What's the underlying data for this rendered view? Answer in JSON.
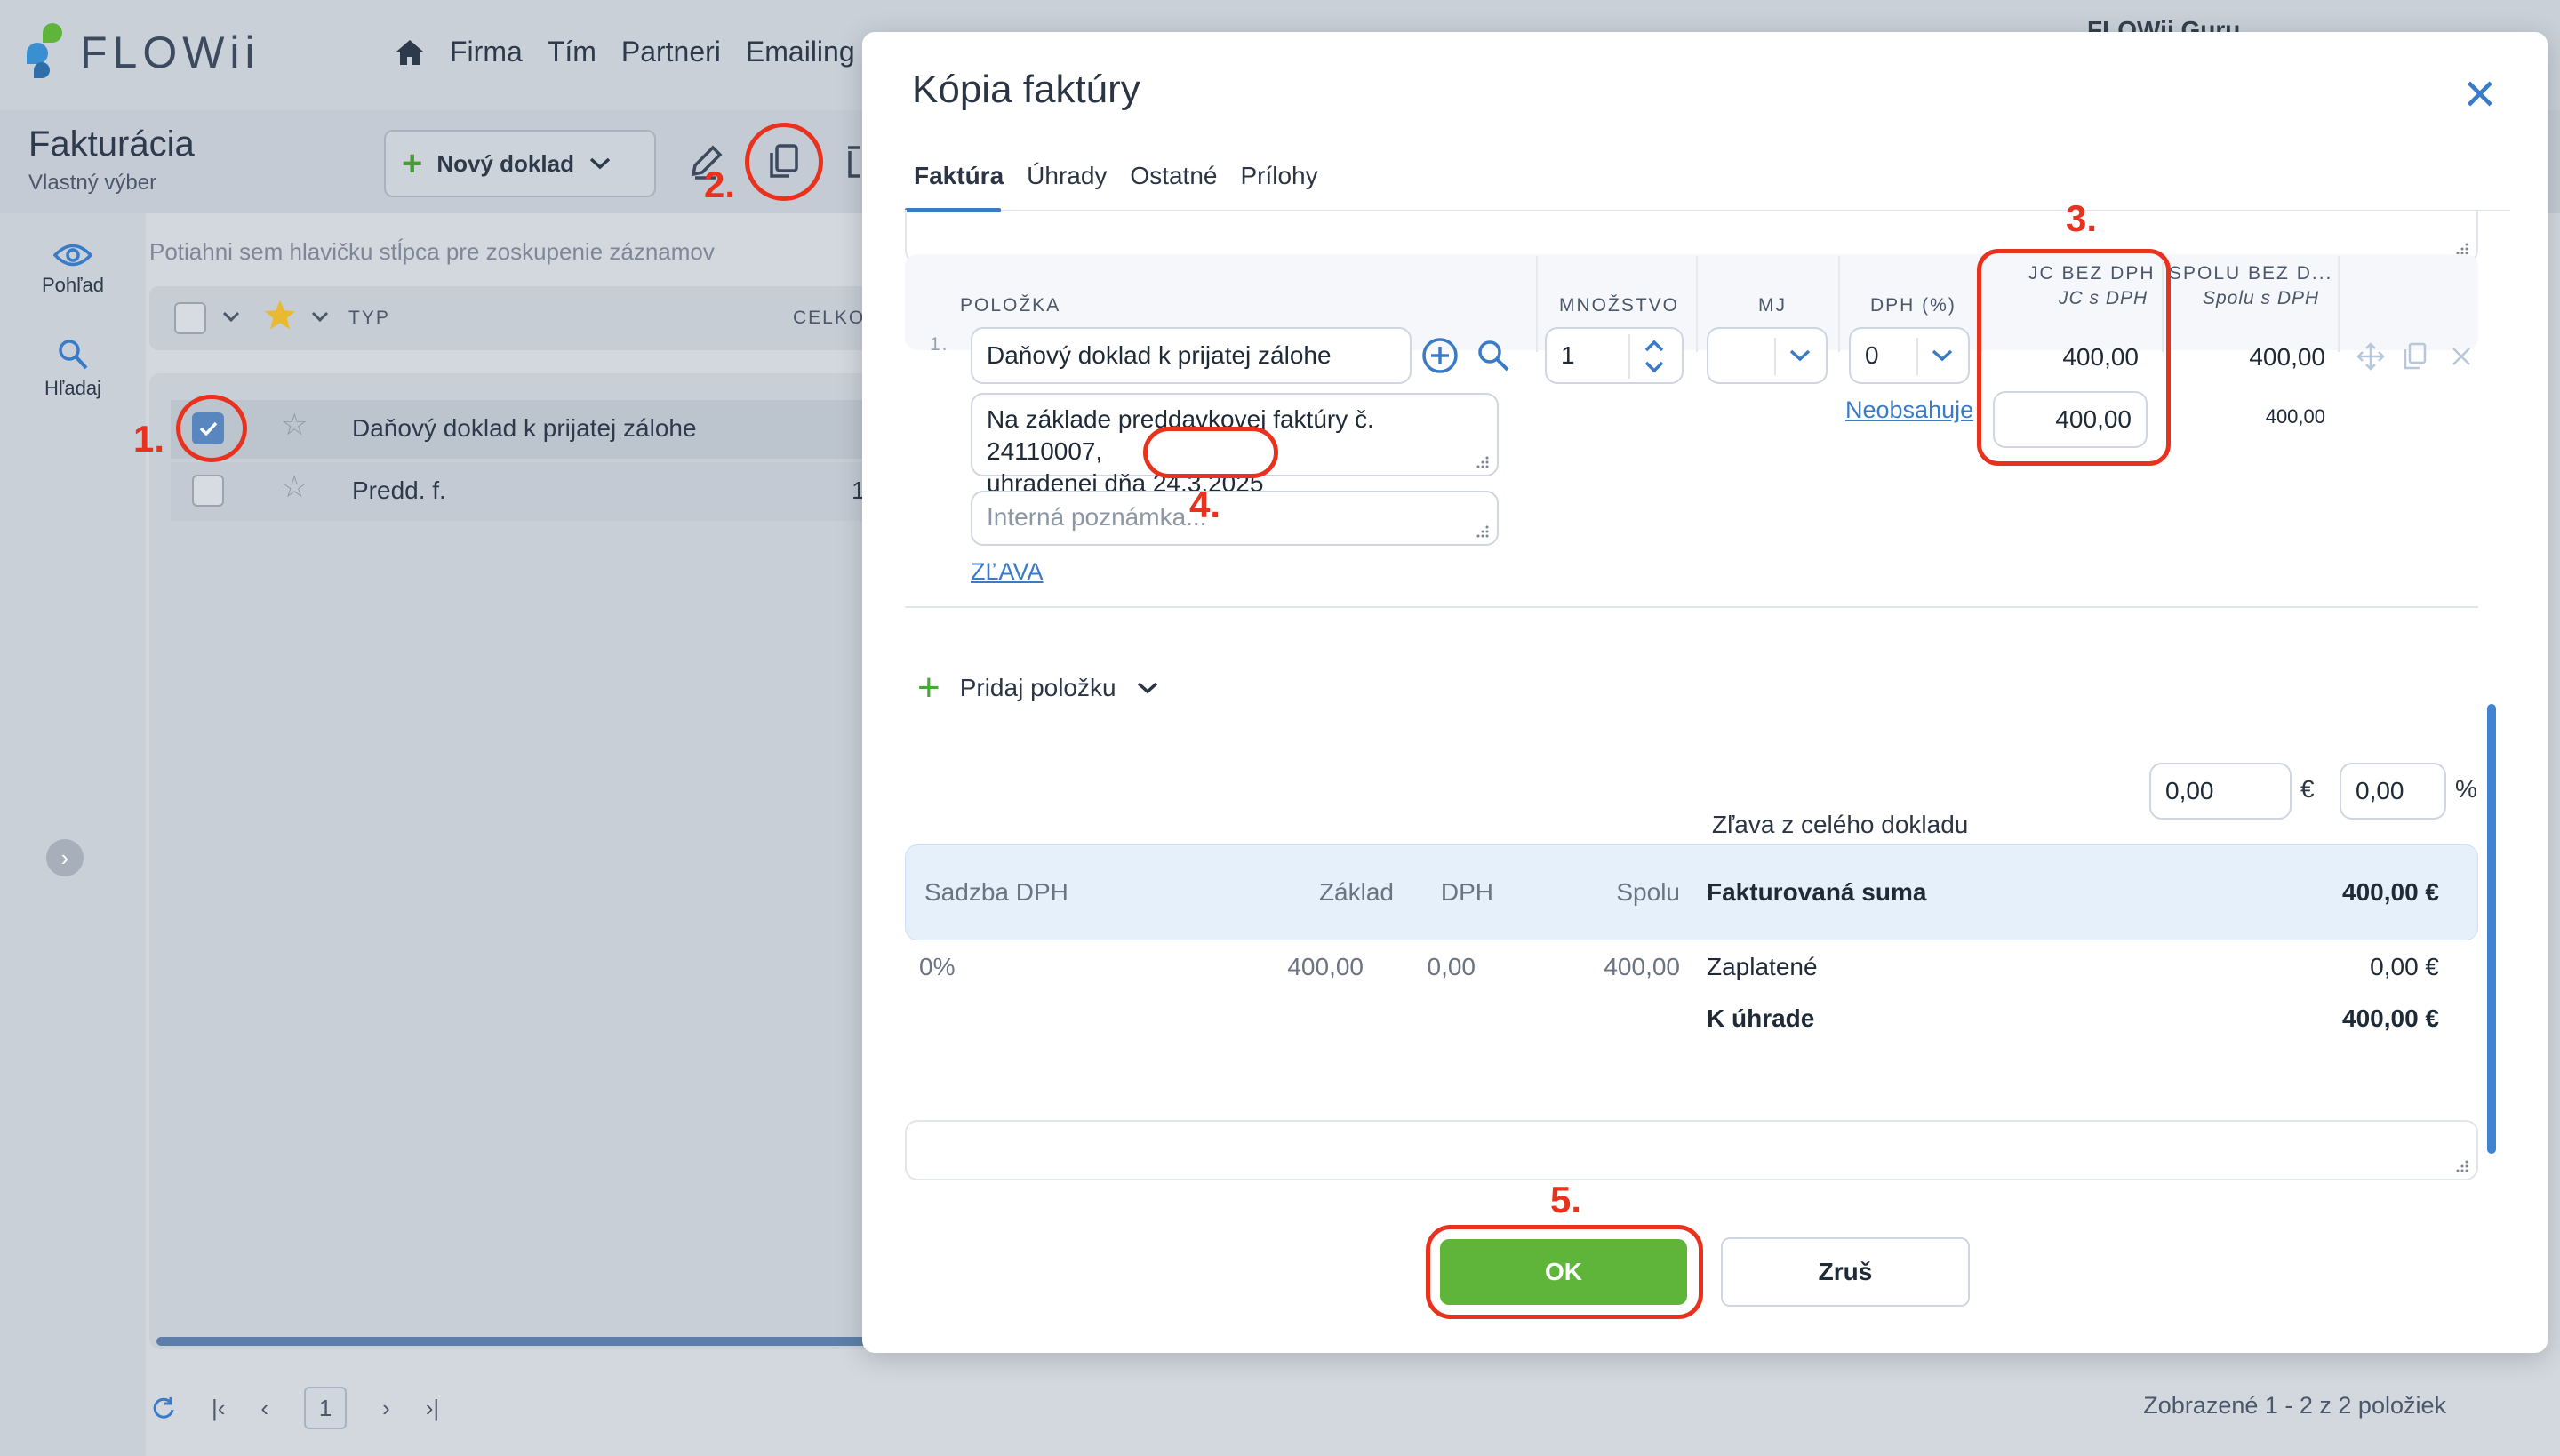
{
  "app": {
    "brand": "FLOWii",
    "nav": [
      "Firma",
      "Tím",
      "Partneri",
      "Emailing"
    ],
    "user": "FLOWii Guru",
    "page_title": "Fakturácia",
    "page_subtitle": "Vlastný výber",
    "new_doc_label": "Nový doklad",
    "sidebar": [
      {
        "label": "Pohľad",
        "icon": "eye-icon"
      },
      {
        "label": "Hľadaj",
        "icon": "search-icon"
      }
    ],
    "group_hint": "Potiahni sem hlavičku stĺpca pre zoskupenie záznamov",
    "grid": {
      "col_typ": "TYP",
      "col_celk": "CELKO",
      "rows": [
        {
          "typ": "Daňový doklad k prijatej zálohe",
          "checked": true,
          "amount": ""
        },
        {
          "typ": "Predd. f.",
          "checked": false,
          "amount": "1"
        }
      ]
    },
    "pager": {
      "page": "1",
      "info": "Zobrazené 1 - 2 z 2 položiek"
    }
  },
  "modal": {
    "title": "Kópia faktúry",
    "tabs": [
      "Faktúra",
      "Úhrady",
      "Ostatné",
      "Prílohy"
    ],
    "columns": {
      "item": "POLOŽKA",
      "qty": "MNOŽSTVO",
      "unit": "MJ",
      "vat": "DPH (%)",
      "unit_price": "JC BEZ DPH",
      "unit_price_sub": "JC s DPH",
      "total": "SPOLU BEZ D...",
      "total_sub": "Spolu s DPH"
    },
    "line": {
      "index": "1.",
      "name": "Daňový doklad k prijatej zálohe",
      "description_line1": "Na základe preddavkovej faktúry č. 24110007,",
      "description_line2_prefix": "uhradenej dňa ",
      "description_date": "24.3.2025",
      "internal_note_placeholder": "Interná poznámka...",
      "discount_link": "ZĽAVA",
      "qty": "1",
      "unit": "",
      "vat": "0",
      "vat_note": "Neobsahuje",
      "unit_price": "400,00",
      "unit_price_vat": "400,00",
      "total": "400,00",
      "total_vat": "400,00"
    },
    "add_item_label": "Pridaj položku",
    "doc_discount_label": "Zľava z celého dokladu",
    "doc_discount_eur": "0,00",
    "doc_discount_pct": "0,00",
    "currency_symbol": "€",
    "percent_symbol": "%",
    "summary": {
      "headers": [
        "Sadzba DPH",
        "Základ",
        "DPH",
        "Spolu"
      ],
      "row": [
        "0%",
        "400,00",
        "0,00",
        "400,00"
      ],
      "invoiced_label": "Fakturovaná suma",
      "invoiced_value": "400,00 €",
      "paid_label": "Zaplatené",
      "paid_value": "0,00 €",
      "due_label": "K úhrade",
      "due_value": "400,00 €"
    },
    "ok_label": "OK",
    "cancel_label": "Zruš"
  },
  "annotations": [
    "1.",
    "2.",
    "3.",
    "4.",
    "5."
  ],
  "colors": {
    "accent": "#3a7bc8",
    "ok_green": "#5fb53a",
    "annotation_red": "#e8321e"
  }
}
